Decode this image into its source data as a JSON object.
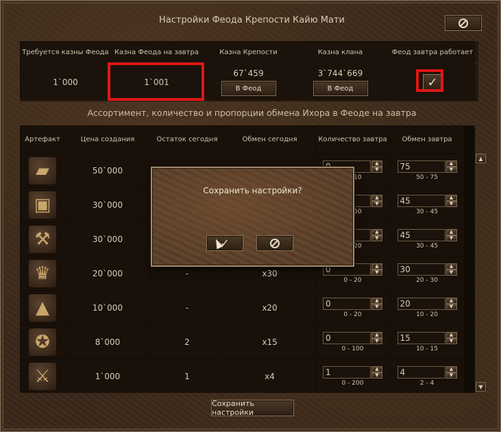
{
  "window": {
    "title": "Настройки Феода Крепости Кайю Мати",
    "close_icon": "cancel-icon"
  },
  "top_table": {
    "headers": [
      "Требуется казны Феода",
      "Казна Феода на завтра",
      "Казна Крепости",
      "Казна клана",
      "Феод завтра работает"
    ],
    "required_treasury": "1`000",
    "tomorrow_treasury": "1`001",
    "fortress_treasury": "67`459",
    "clan_treasury": "3`744`669",
    "to_feod_button": "В Феод",
    "works_tomorrow_check": "✓"
  },
  "subtitle": "Ассортимент, количество и пропорции обмена Ихора в Феоде на завтра",
  "main_table": {
    "headers": [
      "Артефакт",
      "Цена создания",
      "Остаток сегодня",
      "Обмен сегодня",
      "Количество завтра",
      "Обмен завтра"
    ],
    "rows": [
      {
        "icon": "chest-icon",
        "price": "50`000",
        "left": "",
        "exchange": "",
        "qty": "0",
        "qty_range": "0 - 10",
        "rate": "75",
        "rate_range": "50 - 75"
      },
      {
        "icon": "treasure-chest-icon",
        "price": "30`000",
        "left": "",
        "exchange": "",
        "qty": "0",
        "qty_range": "0 - 50",
        "rate": "45",
        "rate_range": "30 - 45"
      },
      {
        "icon": "anvil-icon",
        "price": "30`000",
        "left": "",
        "exchange": "",
        "qty": "0",
        "qty_range": "0 - 20",
        "rate": "45",
        "rate_range": "30 - 45"
      },
      {
        "icon": "crown-icon",
        "price": "20`000",
        "left": "-",
        "exchange": "x30",
        "qty": "0",
        "qty_range": "0 - 20",
        "rate": "30",
        "rate_range": "20 - 30"
      },
      {
        "icon": "pyramid-icon",
        "price": "10`000",
        "left": "-",
        "exchange": "x20",
        "qty": "0",
        "qty_range": "0 - 20",
        "rate": "20",
        "rate_range": "10 - 20"
      },
      {
        "icon": "medallion-icon",
        "price": "8`000",
        "left": "2",
        "exchange": "x15",
        "qty": "0",
        "qty_range": "0 - 100",
        "rate": "15",
        "rate_range": "10 - 15"
      },
      {
        "icon": "hammer-icon",
        "price": "1`000",
        "left": "1",
        "exchange": "x4",
        "qty": "1",
        "qty_range": "0 - 200",
        "rate": "4",
        "rate_range": "2 - 4"
      }
    ]
  },
  "save_button": "Сохранить настройки",
  "dialog": {
    "question": "Сохранить настройки?",
    "ok_icon": "check-icon",
    "ok_glyph": "✓",
    "cancel_icon": "cancel-icon"
  },
  "colors": {
    "highlight": "#e01616",
    "accent_text": "#d8cdb8"
  }
}
